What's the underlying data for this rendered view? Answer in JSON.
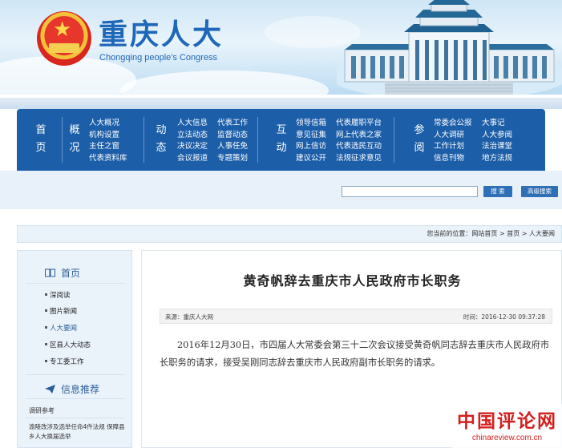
{
  "header": {
    "title": "重庆人大",
    "subtitle": "Chongqing people's Congress"
  },
  "nav": {
    "home": "首页",
    "groups": [
      {
        "title": "概况",
        "items": [
          "人大概况",
          "机构设置",
          "主任之窗",
          "代表资料库"
        ]
      },
      {
        "title": "动态",
        "items": [
          "人大信息",
          "立法动态",
          "决议决定",
          "会议报道",
          "代表工作",
          "监督动态",
          "人事任免",
          "专题策划"
        ]
      },
      {
        "title": "互动",
        "items": [
          "领导信箱",
          "意见征集",
          "网上信访",
          "建议公开",
          "代表履职平台",
          "网上代表之家",
          "代表选民互动",
          "法规征求意见"
        ]
      },
      {
        "title": "参阅",
        "items": [
          "常委会公报",
          "人大调研",
          "工作计划",
          "信息刊物",
          "大事记",
          "人大参阅",
          "法治课堂",
          "地方法规"
        ]
      }
    ]
  },
  "search": {
    "placeholder": "",
    "search_label": "搜 索",
    "advanced_label": "高级搜索"
  },
  "breadcrumb": "您当前的位置：网站首页 > 首页 > 人大要闻",
  "sidebar": {
    "home_label": "首页",
    "items": [
      "深阅读",
      "图片新闻",
      "人大要闻",
      "区县人大动态",
      "专工委工作"
    ],
    "active_index": 2,
    "info_label": "信息推荐",
    "info_items": [
      "调研参考",
      "渝陵改涉及选举任命4件法规 保障县乡人大换届选举"
    ]
  },
  "article": {
    "title": "黄奇帆辞去重庆市人民政府市长职务",
    "source": "来源：重庆人大网",
    "time": "时间：2016-12-30 09:37:28",
    "body": "2016年12月30日，市四届人大常委会第三十二次会议接受黄奇帆同志辞去重庆市人民政府市长职务的请求，接受吴刚同志辞去重庆市人民政府副市长职务的请求。"
  },
  "watermark": {
    "name": "中国评论网",
    "url": "chinareview.com.cn"
  },
  "colors": {
    "nav_blue": "#1d5ea8",
    "title_blue": "#1f67b8",
    "watermark_red": "#d3201f"
  }
}
